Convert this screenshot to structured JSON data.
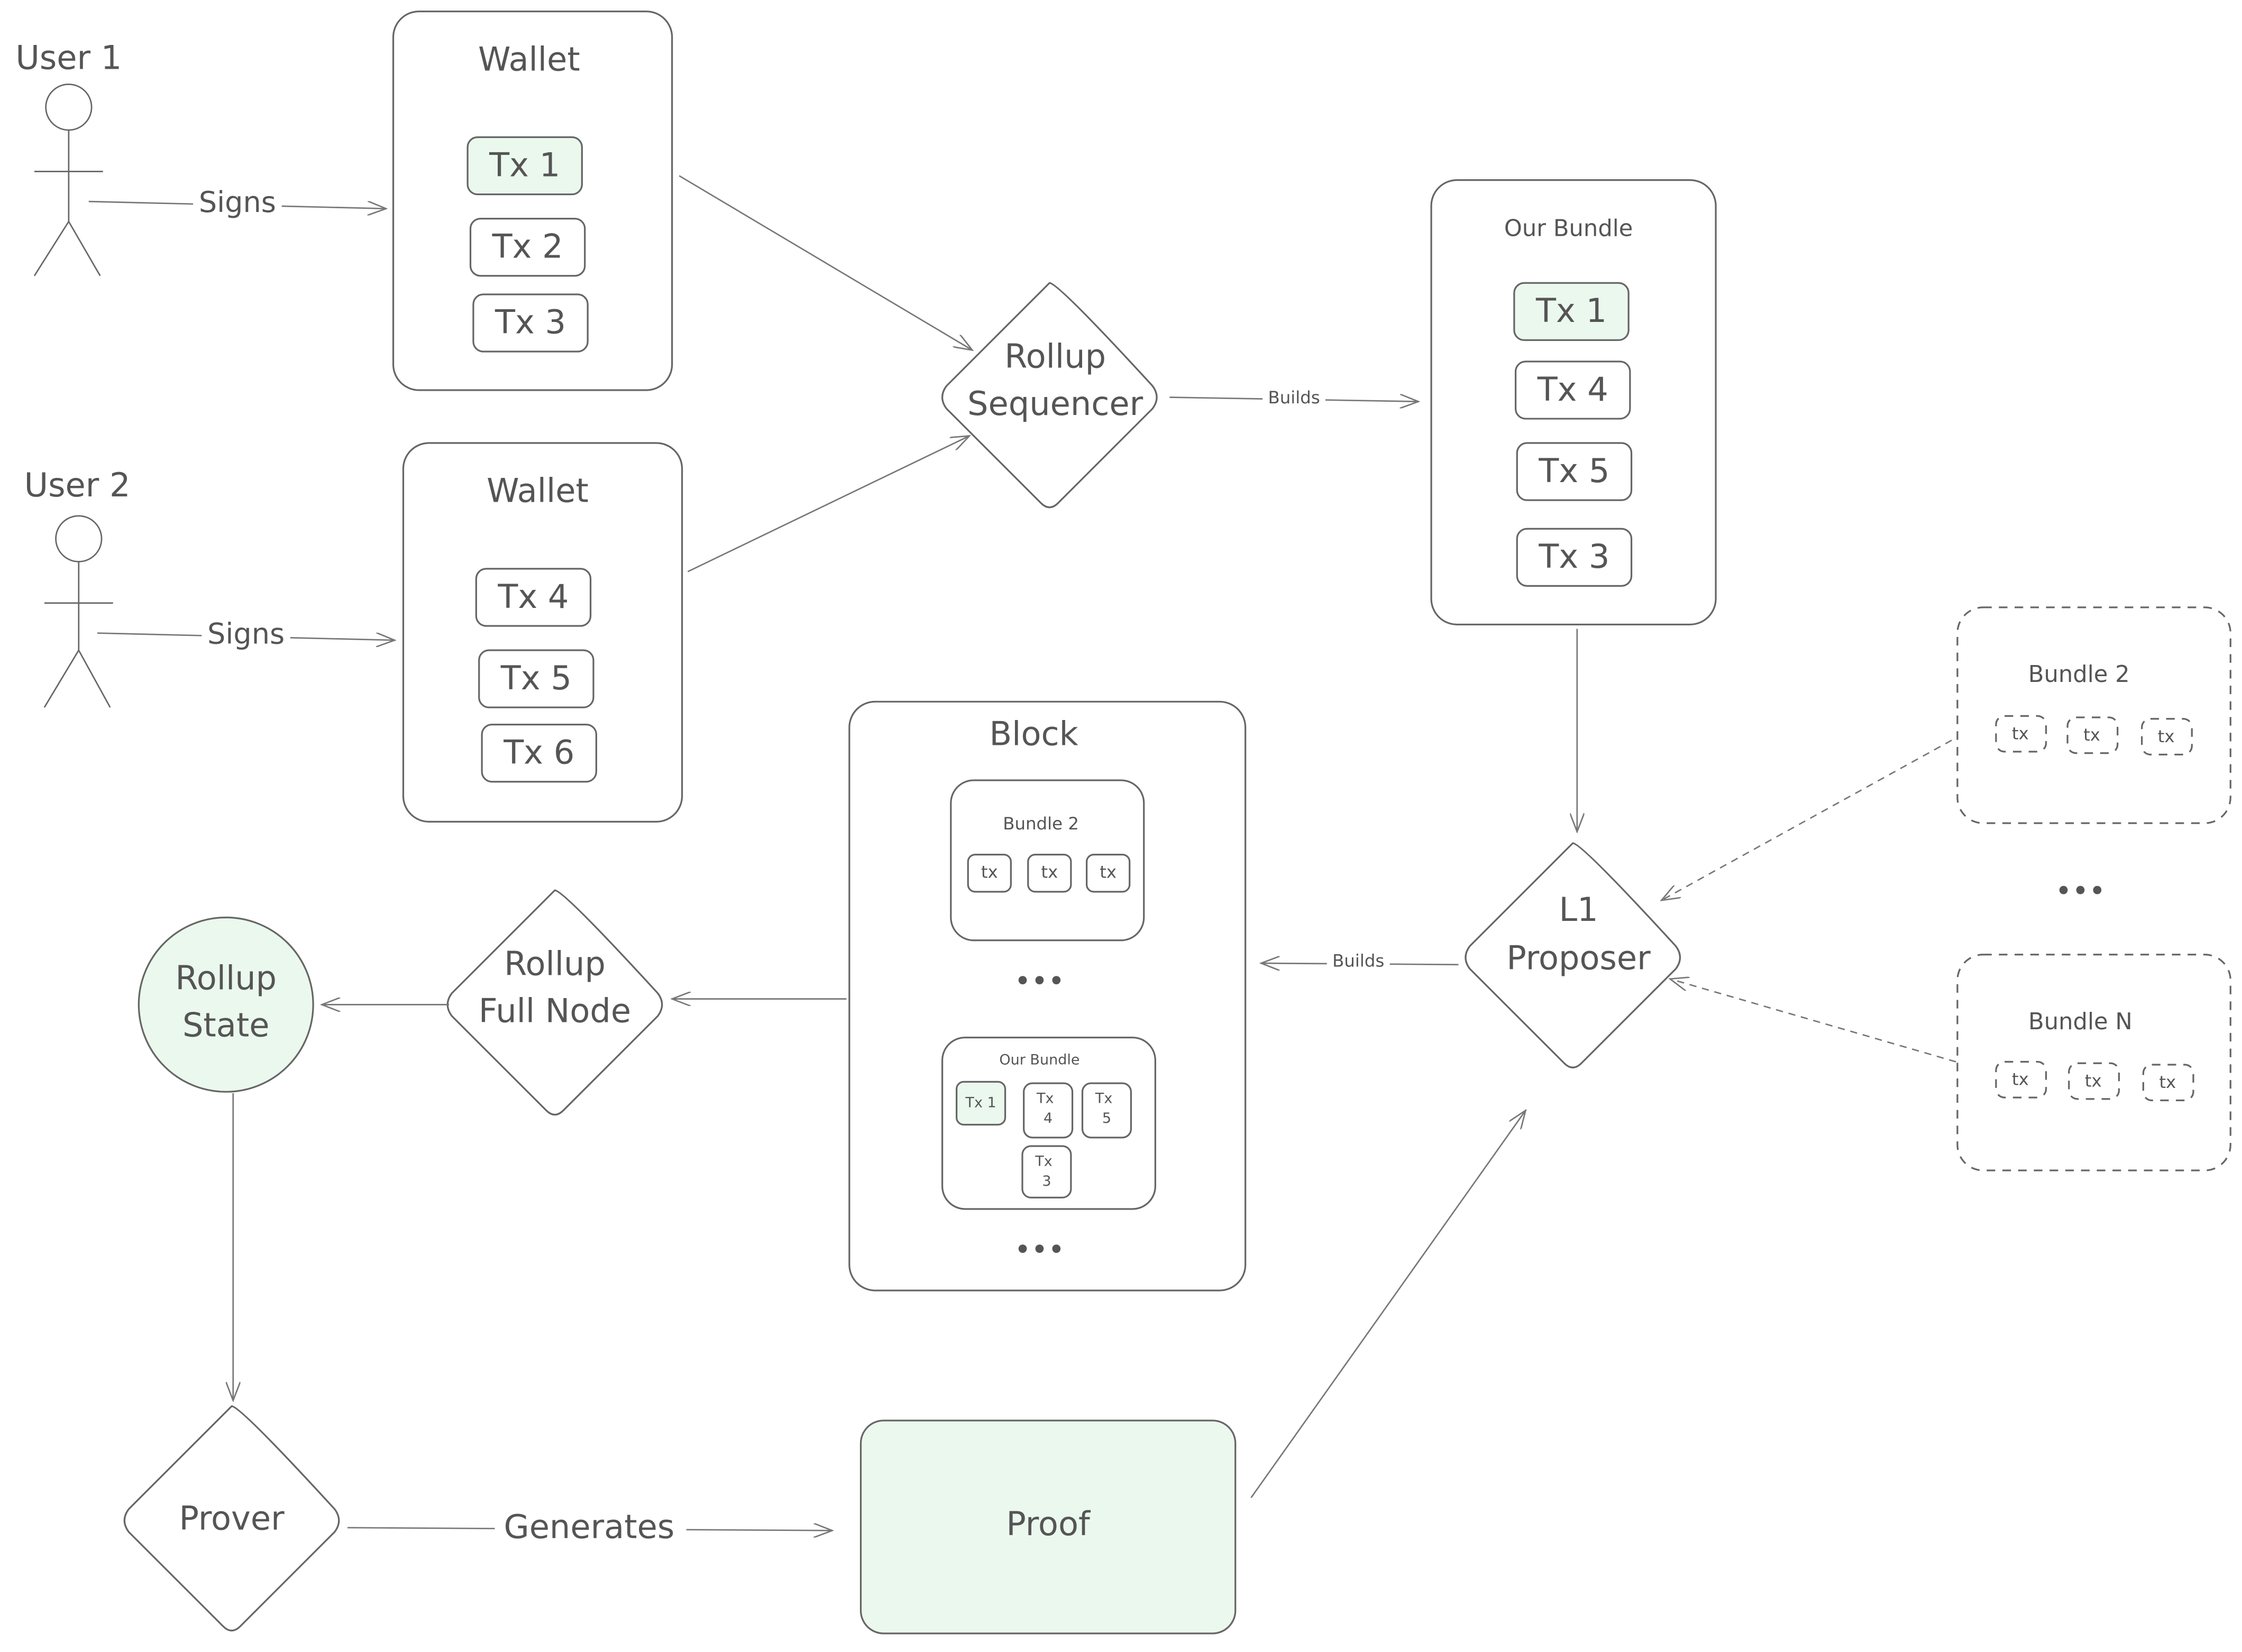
{
  "colors": {
    "stroke": "#666666",
    "text": "#555555",
    "highlight_fill": "#ebf8ee"
  },
  "users": [
    {
      "label": "User 1",
      "action": "Signs",
      "icon": "stick-figure-icon"
    },
    {
      "label": "User 2",
      "action": "Signs",
      "icon": "stick-figure-icon"
    }
  ],
  "wallets": [
    {
      "title": "Wallet",
      "txs": [
        "Tx 1",
        "Tx 2",
        "Tx 3"
      ],
      "highlighted": [
        "Tx 1"
      ]
    },
    {
      "title": "Wallet",
      "txs": [
        "Tx 4",
        "Tx 5",
        "Tx 6"
      ],
      "highlighted": []
    }
  ],
  "sequencer": {
    "line1": "Rollup",
    "line2": "Sequencer"
  },
  "sequencer_edge": "Builds",
  "our_bundle": {
    "title": "Our Bundle",
    "txs": [
      "Tx 1",
      "Tx 4",
      "Tx 5",
      "Tx 3"
    ],
    "highlighted": [
      "Tx 1"
    ]
  },
  "other_bundles": [
    {
      "title": "Bundle 2",
      "txs": [
        "tx",
        "tx",
        "tx"
      ]
    },
    {
      "title": "Bundle N",
      "txs": [
        "tx",
        "tx",
        "tx"
      ]
    }
  ],
  "other_bundles_ellipsis": "•••",
  "proposer": {
    "line1": "L1",
    "line2": "Proposer"
  },
  "proposer_edge": "Builds",
  "block": {
    "title": "Block",
    "bundle2": {
      "title": "Bundle 2",
      "txs": [
        "tx",
        "tx",
        "tx"
      ]
    },
    "ellipsis": "•••",
    "our_bundle": {
      "title": "Our Bundle",
      "txs": [
        {
          "l1": "Tx 1",
          "l2": ""
        },
        {
          "l1": "Tx",
          "l2": "4"
        },
        {
          "l1": "Tx",
          "l2": "5"
        },
        {
          "l1": "Tx",
          "l2": "3"
        }
      ]
    },
    "ellipsis_bottom": "•••"
  },
  "full_node": {
    "line1": "Rollup",
    "line2": "Full Node"
  },
  "rollup_state": {
    "line1": "Rollup",
    "line2": "State"
  },
  "prover": {
    "label": "Prover"
  },
  "prover_edge": "Generates",
  "proof": {
    "label": "Proof"
  }
}
